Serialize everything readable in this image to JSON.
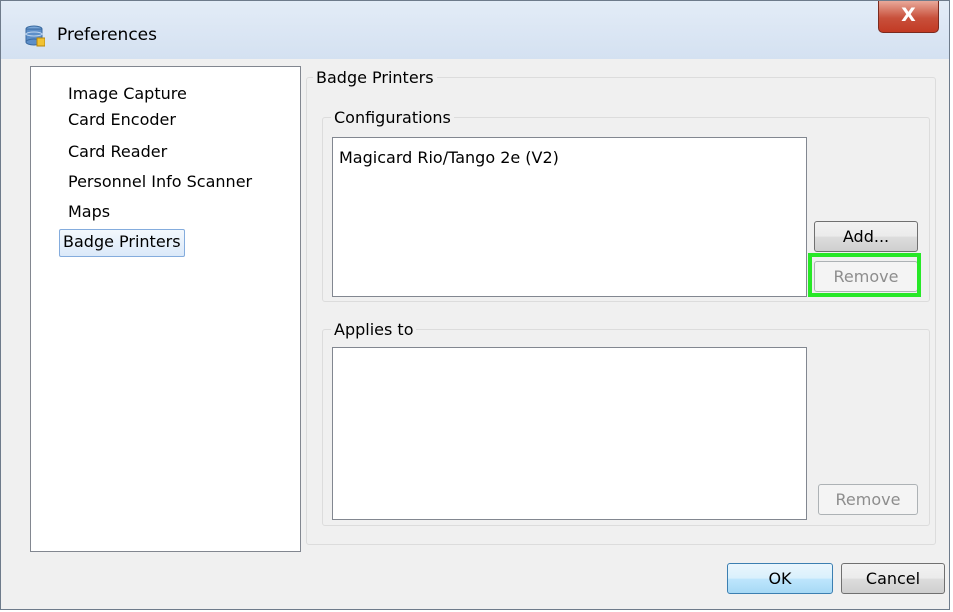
{
  "window": {
    "title": "Preferences",
    "close_label": "X"
  },
  "nav": {
    "items": [
      {
        "label": "Image Capture",
        "selected": false
      },
      {
        "label": "Card Encoder",
        "selected": false
      },
      {
        "label": "Card Reader",
        "selected": false
      },
      {
        "label": "Personnel Info Scanner",
        "selected": false
      },
      {
        "label": "Maps",
        "selected": false
      },
      {
        "label": "Badge Printers",
        "selected": true
      }
    ]
  },
  "panel": {
    "title": "Badge Printers",
    "configurations": {
      "label": "Configurations",
      "items": [
        "Magicard Rio/Tango 2e (V2)"
      ],
      "add_label": "Add...",
      "remove_label": "Remove"
    },
    "applies_to": {
      "label": "Applies to",
      "items": [],
      "remove_label": "Remove"
    }
  },
  "footer": {
    "ok_label": "OK",
    "cancel_label": "Cancel"
  },
  "colors": {
    "highlight": "#27e827",
    "close_button": "#c8503b"
  }
}
